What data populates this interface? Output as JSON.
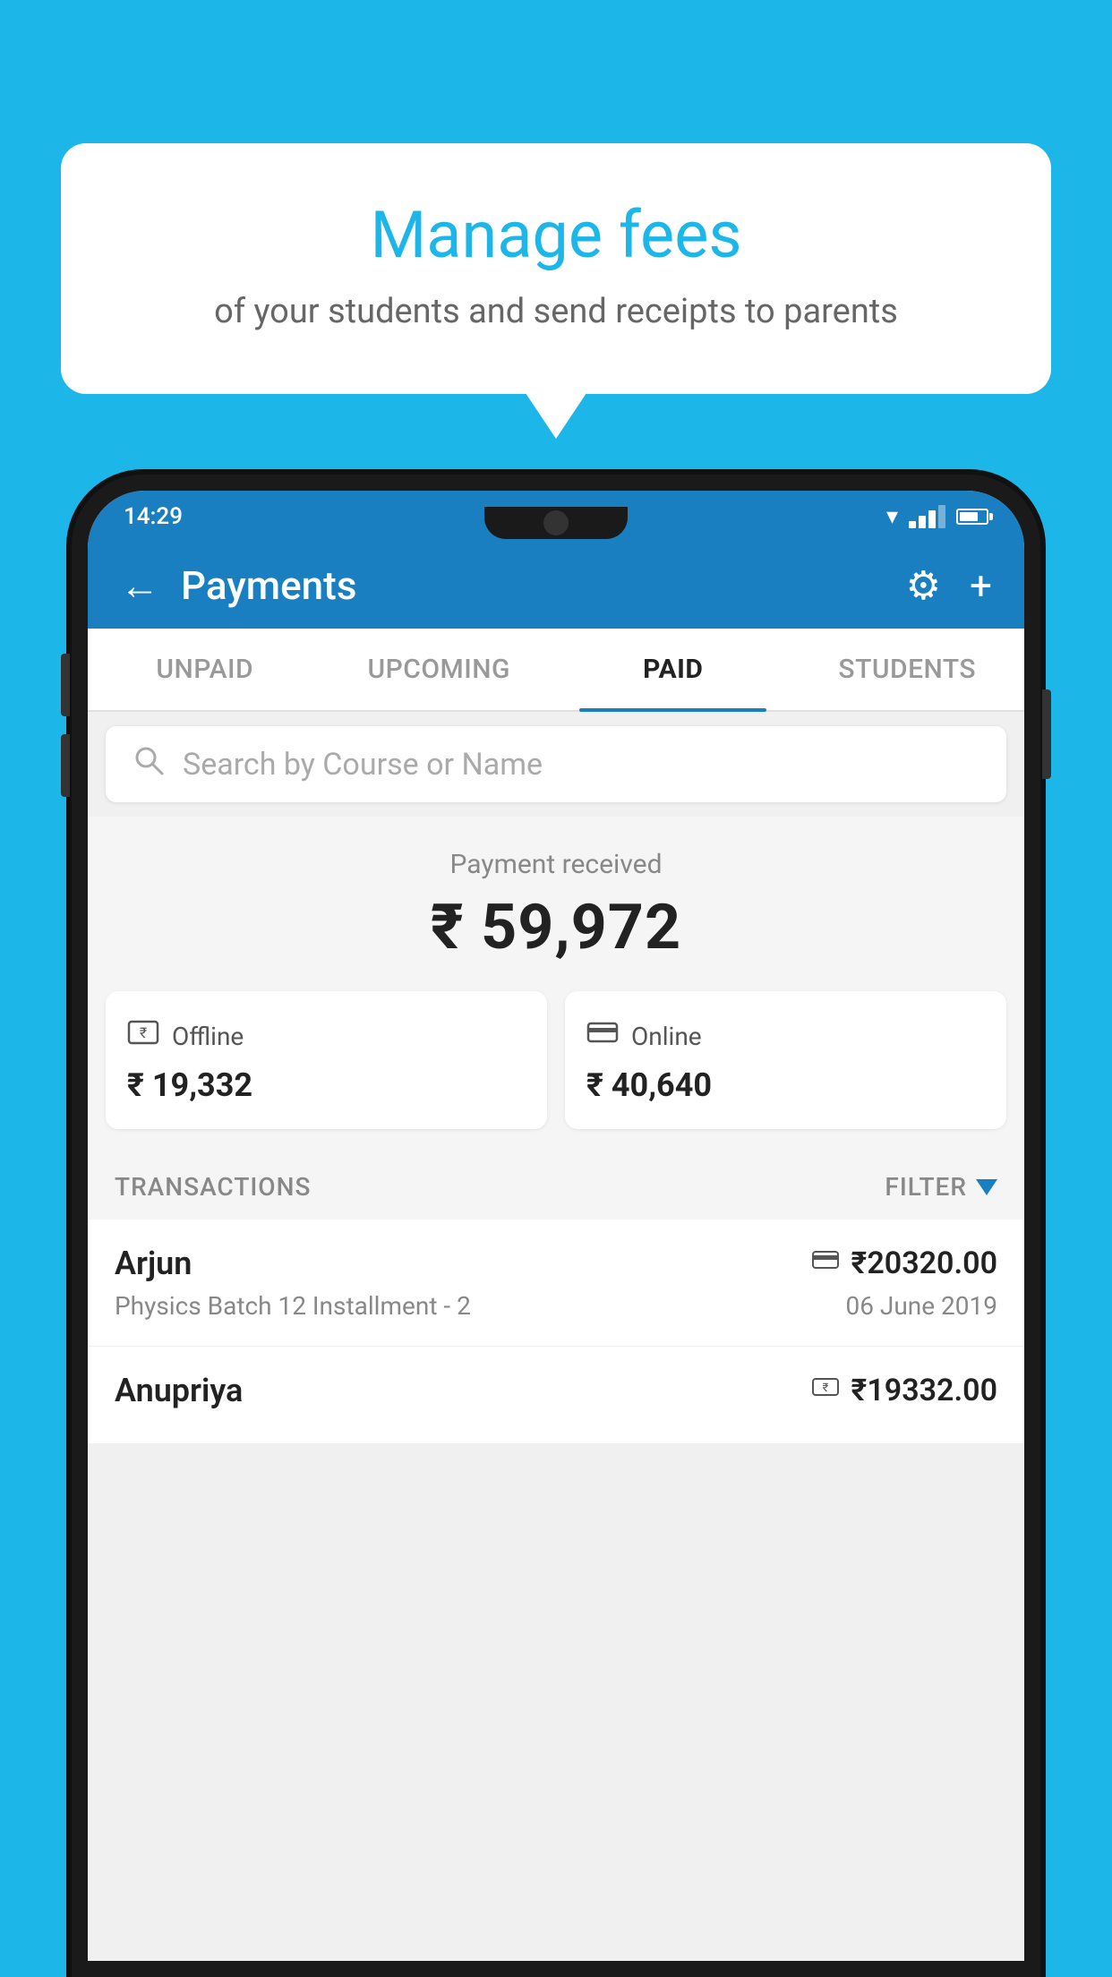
{
  "background_color": "#1db6e8",
  "speech_bubble": {
    "title": "Manage fees",
    "subtitle": "of your students and send receipts to parents"
  },
  "status_bar": {
    "time": "14:29"
  },
  "app_bar": {
    "title": "Payments",
    "back_label": "←",
    "gear_label": "⚙",
    "plus_label": "+"
  },
  "tabs": [
    {
      "label": "UNPAID",
      "active": false
    },
    {
      "label": "UPCOMING",
      "active": false
    },
    {
      "label": "PAID",
      "active": true
    },
    {
      "label": "STUDENTS",
      "active": false
    }
  ],
  "search": {
    "placeholder": "Search by Course or Name"
  },
  "payment_received": {
    "label": "Payment received",
    "amount": "₹ 59,972",
    "offline_label": "Offline",
    "offline_amount": "₹ 19,332",
    "online_label": "Online",
    "online_amount": "₹ 40,640"
  },
  "transactions": {
    "header": "TRANSACTIONS",
    "filter": "FILTER",
    "items": [
      {
        "name": "Arjun",
        "course": "Physics Batch 12 Installment - 2",
        "amount": "₹20320.00",
        "date": "06 June 2019",
        "payment_type": "online"
      },
      {
        "name": "Anupriya",
        "course": "",
        "amount": "₹19332.00",
        "date": "",
        "payment_type": "offline"
      }
    ]
  }
}
